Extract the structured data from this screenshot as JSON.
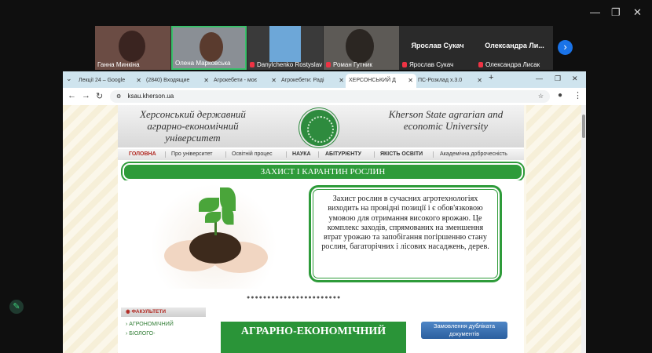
{
  "window_controls": {
    "minimize": "—",
    "maximize": "❐",
    "close": "✕"
  },
  "participants": [
    {
      "name": "Ганна Минкіна",
      "muted": false
    },
    {
      "name": "Олена Марковська",
      "muted": false
    },
    {
      "name": "Danylchenko Rostyslav",
      "muted": true
    },
    {
      "name": "Роман Гутник",
      "muted": true
    },
    {
      "name": "Ярослав Сукач",
      "muted": true,
      "big_label": "Ярослав Сукач"
    },
    {
      "name": "Олександра Лисак",
      "muted": true,
      "big_label": "Олександра Ли..."
    }
  ],
  "browser": {
    "tabs": [
      {
        "label": "Лекції 24 – Google"
      },
      {
        "label": "(2840) Входящие"
      },
      {
        "label": "Агрокебети - моє"
      },
      {
        "label": "Агрокебети: Раді"
      },
      {
        "label": "ХЕРСОНСЬКИЙ Д",
        "active": true
      },
      {
        "label": "ПС-Розклад х.3.0"
      }
    ],
    "new_tab": "+",
    "url": "ksau.kherson.ua"
  },
  "site": {
    "header_left": "Херсонський державний аграрно-економічний університет",
    "header_right": "Kherson State agrarian and economic University",
    "menu": [
      "ГОЛОВНА",
      "Про університет",
      "Освітній процес",
      "НАУКА",
      "АБІТУРІЄНТУ",
      "ЯКІСТЬ ОСВІТИ",
      "Академічна доброчесність"
    ],
    "section_title": "ЗАХИСТ І КАРАНТИН РОСЛИН",
    "banner_text": "Захист рослин в сучасних агротехнологіях виходить на провідні позиції і є обов'язковою умовою для отримання високого врожаю. Це комплекс заходів, спрямованих на зменшення втрат урожаю та запобігання погіршенню стану рослин, багаторічних і лісових насаджень, дерев.",
    "slider_dots": "●●●●●●●●●●●●●●●●●●●●●●●",
    "faculties_title": "ФАКУЛЬТЕТИ",
    "faculties": [
      "АГРОНОМІЧНИЙ",
      "БІОЛОГО-"
    ],
    "agro_banner": "АГРАРНО-ЕКОНОМІЧНИЙ",
    "order_button": "Замовлення дубліката документів"
  }
}
